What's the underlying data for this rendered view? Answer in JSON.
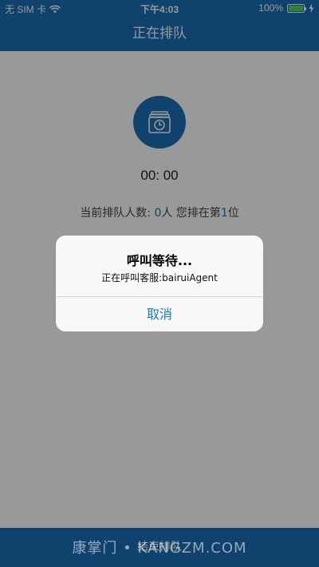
{
  "status_bar": {
    "carrier": "无 SIM 卡",
    "time": "下午4:03",
    "battery": "100%"
  },
  "nav": {
    "title": "正在排队"
  },
  "queue": {
    "timer": "00: 00",
    "prefix": "当前排队人数: ",
    "count": "0",
    "mid": "人 您排在第",
    "position": "1",
    "suffix": "位"
  },
  "bottom_bar": {
    "label": "结束排队"
  },
  "alert": {
    "title": "呼叫等待...",
    "message": "正在呼叫客服:bairuiAgent",
    "cancel_label": "取消"
  },
  "watermark": {
    "text": "康掌门 • KANGZM.COM"
  },
  "colors": {
    "primary": "#1a6fb4",
    "alert_button": "#1a7ad2",
    "battery": "#4cd964"
  },
  "icons": {
    "wifi": "wifi-icon",
    "battery": "battery-icon",
    "charging": "charging-icon",
    "queue": "clock-icon"
  }
}
